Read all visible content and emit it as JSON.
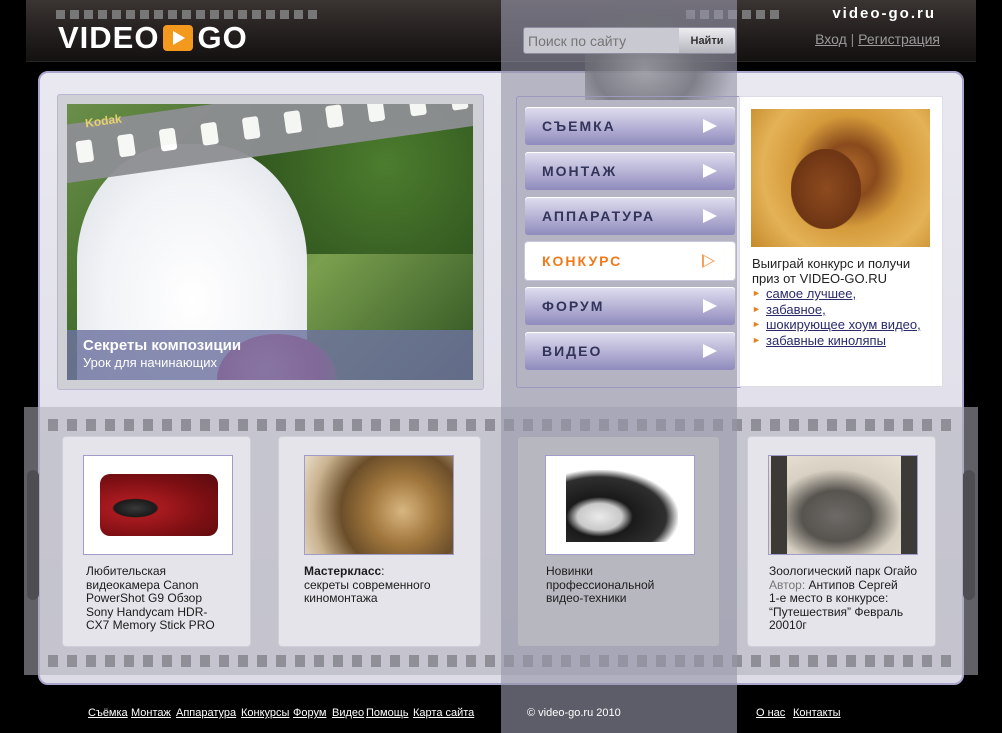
{
  "header": {
    "logo_left": "VIDEO",
    "logo_right": "GO",
    "site_name": "video-go.ru",
    "login": "Вход",
    "separator": "|",
    "register": "Регистрация"
  },
  "search": {
    "placeholder": "Поиск по сайту",
    "button": "Найти"
  },
  "hero": {
    "film_brand": "Kodak",
    "title": "Секреты композиции",
    "subtitle": "Урок для начинающих"
  },
  "menu": [
    {
      "label": "СЪЕМКА",
      "active": false
    },
    {
      "label": "МОНТАЖ",
      "active": false
    },
    {
      "label": "АППАРАТУРА",
      "active": false
    },
    {
      "label": "КОНКУРС",
      "active": true
    },
    {
      "label": "ФОРУМ",
      "active": false
    },
    {
      "label": "ВИДЕО",
      "active": false
    }
  ],
  "contest": {
    "text": "Выиграй конкурс и получи приз от VIDEO-GO.RU",
    "links": [
      "самое лучшее,",
      "забавное,",
      "шокирующее хоум видео,",
      "забавные киноляпы"
    ]
  },
  "cards": [
    {
      "lines": [
        "Любительская",
        "видеокамера Canon",
        "PowerShot G9 Обзор",
        "Sony Handycam HDR-",
        "CX7 Memory Stick PRO"
      ]
    },
    {
      "bold": "Мастеркласс",
      "after_bold": ":",
      "lines": [
        "секреты современного",
        "киномонтажа"
      ]
    },
    {
      "lines": [
        "Новинки",
        "профессиональной",
        "видео-техники"
      ]
    },
    {
      "title": "Зоологический парк Огайо",
      "author_label": "Автор:",
      "author": "Антипов Сергей",
      "lines": [
        "1-е место в конкурсе:",
        "“Путешествия” Февраль",
        "20010г"
      ]
    }
  ],
  "footer": {
    "links_left": [
      "Съёмка",
      "Монтаж",
      "Аппаратура",
      "Конкурсы",
      "Форум",
      "Видео",
      "Помощь",
      "Карта сайта"
    ],
    "copyright": "© video-go.ru 2010",
    "links_right": [
      "О нас",
      "Контакты"
    ]
  },
  "colors": {
    "accent": "#f07a1a",
    "menu_text": "#33345a",
    "panel_border": "#a9a6cc",
    "link": "#2a2b6a"
  }
}
